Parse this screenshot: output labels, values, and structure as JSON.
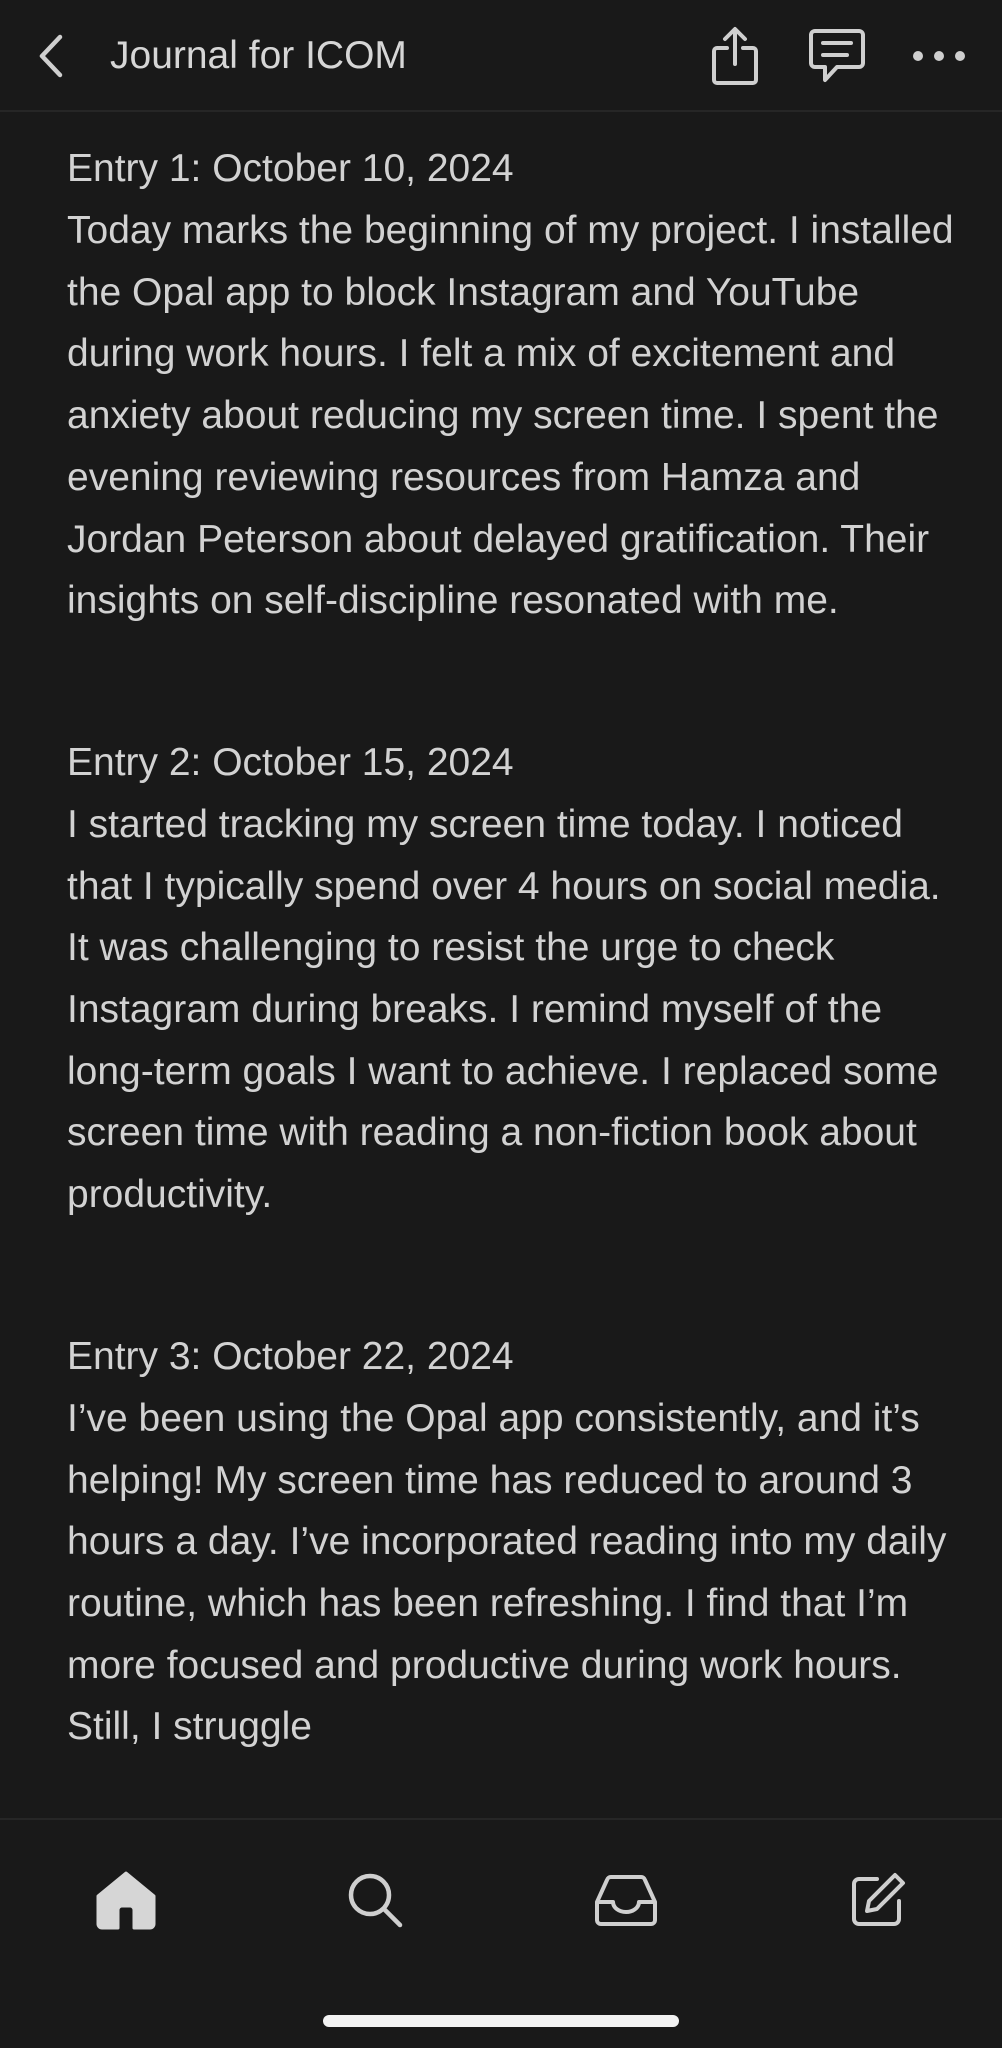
{
  "header": {
    "title": "Journal for ICOM",
    "icons": {
      "back": "chevron-left-icon",
      "share": "share-icon",
      "comments": "comment-icon",
      "more": "more-horizontal-icon"
    }
  },
  "entries": [
    {
      "heading": "Entry 1: October 10, 2024",
      "body": "Today marks the beginning of my project. I installed the Opal app to block Instagram and YouTube during work hours. I felt a mix of excitement and anxiety about reducing my screen time. I spent the evening reviewing resources from Hamza and Jordan Peterson about delayed gratification. Their insights on self-discipline resonated with me."
    },
    {
      "heading": "Entry 2: October 15, 2024",
      "body": "I started tracking my screen time today. I noticed that I typically spend over 4 hours on social media. It was challenging to resist the urge to check Instagram during breaks. I remind myself of the long-term goals I want to achieve. I replaced some screen time with reading a non-fiction book about productivity."
    },
    {
      "heading": "Entry 3: October 22, 2024",
      "body": "I’ve been using the Opal app consistently, and it’s helping! My screen time has reduced to around 3 hours a day. I’ve incorporated reading into my daily routine, which has been refreshing. I find that I’m more focused and productive during work hours. Still, I struggle"
    }
  ],
  "tabbar": {
    "tabs": [
      {
        "name": "home",
        "icon": "home-icon"
      },
      {
        "name": "search",
        "icon": "search-icon"
      },
      {
        "name": "inbox",
        "icon": "inbox-icon"
      },
      {
        "name": "compose",
        "icon": "compose-icon"
      }
    ]
  },
  "colors": {
    "background": "#191919",
    "text": "#d2d2d2",
    "icon": "#cfcfcf",
    "divider": "#262626"
  }
}
